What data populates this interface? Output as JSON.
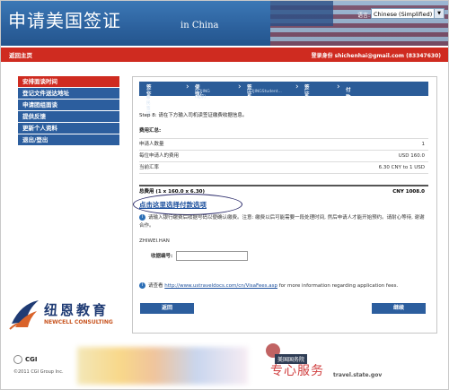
{
  "header": {
    "title_cn": "申请美国签证",
    "title_en": "in China",
    "language_label": "语言:",
    "language_value": "Chinese (Simplified)"
  },
  "topbar": {
    "home_label": "返回主页",
    "login_label": "登录身份  shichenhai@gmail.com (83347630)"
  },
  "sidebar": {
    "items": [
      {
        "label": "安排面谈时间",
        "active": true
      },
      {
        "label": "登记文件送达地址",
        "active": false
      },
      {
        "label": "申请团组面谈",
        "active": false
      },
      {
        "label": "提供反馈",
        "active": false
      },
      {
        "label": "更新个人资料",
        "active": false
      },
      {
        "label": "退出/登出",
        "active": false
      }
    ]
  },
  "steps": [
    {
      "title": "签证类型",
      "sub": "非移民签证"
    },
    {
      "title": "使馆/领事馆",
      "sub": "BEIJING (北京)"
    },
    {
      "title": "签证申请归类",
      "sub": "BEIJINGStudent..."
    },
    {
      "title": "签证类别",
      "sub": "F-1"
    },
    {
      "title": "付款",
      "sub": ""
    }
  ],
  "main": {
    "step_instruction": "Step 8: 请在下方输入司机读签证缴费收据信息。",
    "summary_title": "费用汇总:",
    "rows": [
      {
        "label": "申请人数量",
        "value": "1"
      },
      {
        "label": "每位申请人的费用",
        "value": "USD 160.0"
      },
      {
        "label": "当前汇率",
        "value": "6.30 CNY to 1 USD"
      }
    ],
    "total_label": "总费用 (1 x 160.0 x 6.30)",
    "total_value": "CNY 1008.0",
    "pay_link": "点击这里选择付款选项",
    "info_text": "请输入银行缴费后收据号码以便确认缴费。注意: 缴费以后可能需要一段处理时间, 然后申请人才能开始预约。请耐心等待, 谢谢合作。",
    "applicant_name": "ZHIWEI.HAN",
    "receipt_label": "收据编号:",
    "receipt_value": "",
    "info2_prefix": "请查看",
    "info2_link": "http://www.ustraveldocs.com/cn/VisaFees.asp",
    "info2_suffix": "for more information regarding application fees.",
    "back_button": "返回",
    "continue_button": "继续"
  },
  "logo": {
    "name_cn": "纽恩教育",
    "name_en": "NEWCELL CONSULTING"
  },
  "footer": {
    "cgi_label": "CGI",
    "copyright": "©2011 CGI Group Inc.",
    "dos_label": "美国国务院",
    "dos_url": "travel.state.gov",
    "brush_text": "专心服务"
  },
  "colors": {
    "red": "#cf2b20",
    "blue": "#2c5e9e",
    "link": "#1a4e9c"
  }
}
